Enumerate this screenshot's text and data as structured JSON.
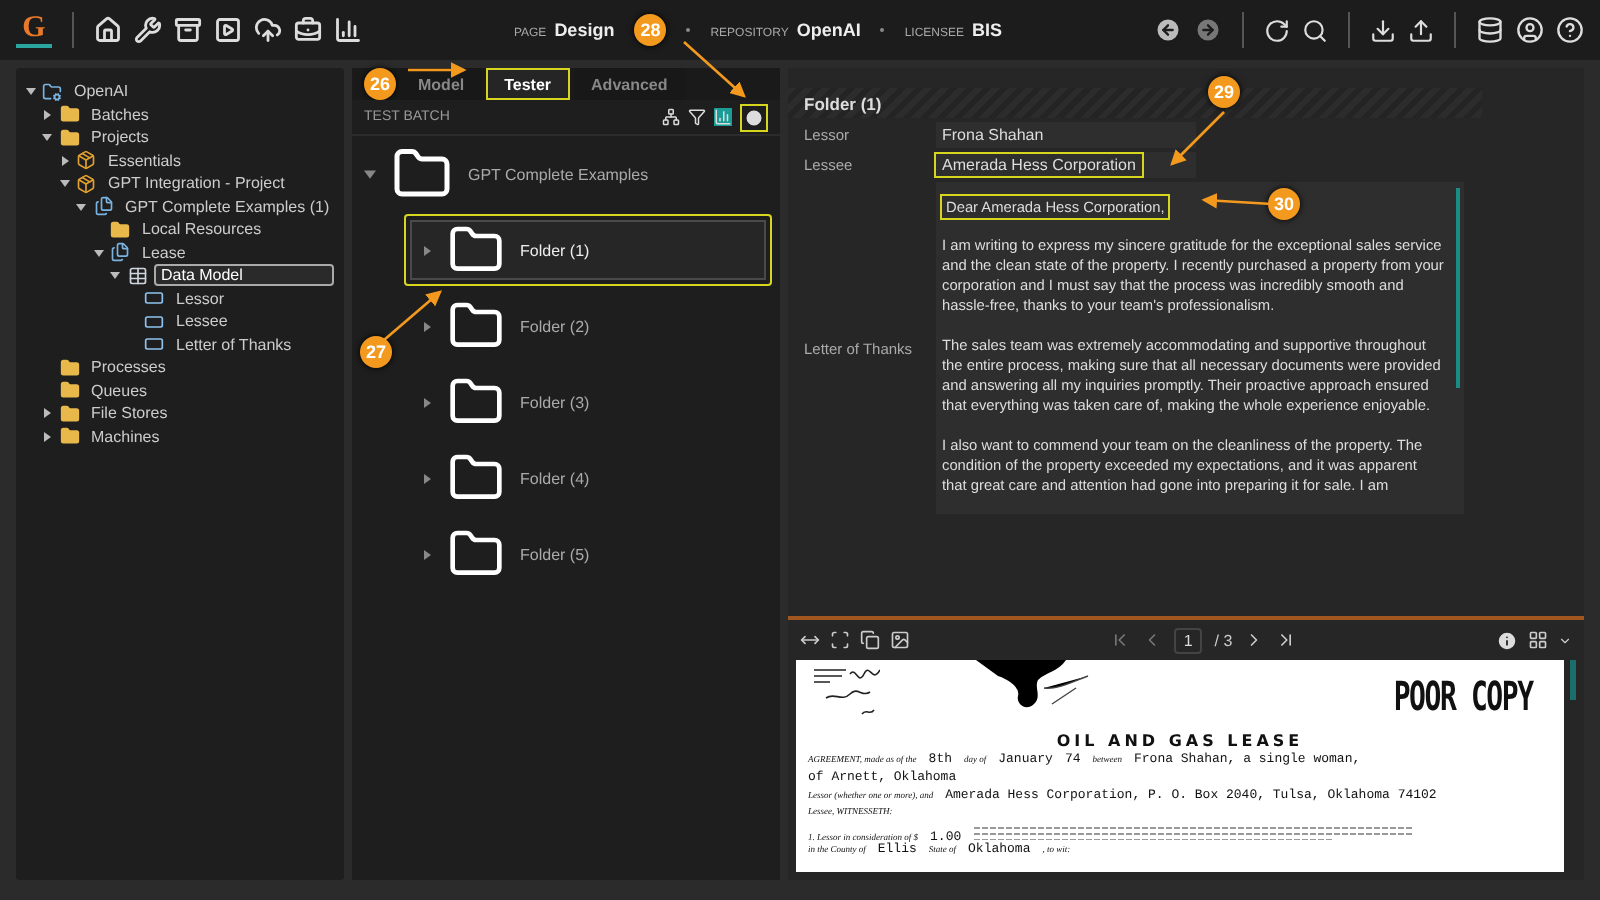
{
  "topbar": {
    "logo": "G",
    "context": [
      {
        "label": "PAGE",
        "value": "Design"
      },
      {
        "label": "REPOSITORY",
        "value": "OpenAI"
      },
      {
        "label": "LICENSEE",
        "value": "BIS"
      }
    ],
    "callout": {
      "number": "28"
    }
  },
  "tree": [
    {
      "label": "OpenAI",
      "kind": "repo",
      "expanded": true,
      "selected": false,
      "children": [
        {
          "label": "Batches",
          "kind": "folder",
          "expanded": false,
          "selected": false
        },
        {
          "label": "Projects",
          "kind": "folder",
          "expanded": true,
          "selected": false,
          "children": [
            {
              "label": "Essentials",
              "kind": "project",
              "expanded": false,
              "selected": false
            },
            {
              "label": "GPT Integration - Project",
              "kind": "project",
              "expanded": true,
              "selected": false,
              "children": [
                {
                  "label": "GPT Complete Examples (1)",
                  "kind": "examples",
                  "expanded": true,
                  "selected": false,
                  "children": [
                    {
                      "label": "Local Resources",
                      "kind": "folder",
                      "selected": false
                    },
                    {
                      "label": "Lease",
                      "kind": "examples",
                      "expanded": true,
                      "selected": false,
                      "children": [
                        {
                          "label": "Data Model",
                          "kind": "model",
                          "expanded": true,
                          "selected": true,
                          "children": [
                            {
                              "label": "Lessor",
                              "kind": "field",
                              "selected": false
                            },
                            {
                              "label": "Lessee",
                              "kind": "field",
                              "selected": false
                            },
                            {
                              "label": "Letter of Thanks",
                              "kind": "field",
                              "selected": false
                            }
                          ]
                        }
                      ]
                    }
                  ]
                }
              ]
            }
          ]
        },
        {
          "label": "Processes",
          "kind": "folder",
          "selected": false
        },
        {
          "label": "Queues",
          "kind": "folder",
          "selected": false
        },
        {
          "label": "File Stores",
          "kind": "folder",
          "expanded": false,
          "selected": false
        },
        {
          "label": "Machines",
          "kind": "folder",
          "expanded": false,
          "selected": false
        }
      ]
    }
  ],
  "tester": {
    "callout": {
      "number": "26"
    },
    "tabs": [
      {
        "label": "Model",
        "selected": false,
        "highlighted": false
      },
      {
        "label": "Tester",
        "selected": true,
        "highlighted": true
      },
      {
        "label": "Advanced",
        "selected": false,
        "highlighted": false
      }
    ],
    "toolbar_title": "TEST BATCH",
    "run_highlighted": true,
    "root": {
      "label": "GPT Complete Examples",
      "expanded": true
    },
    "folders": [
      {
        "label": "Folder (1)",
        "selected": true,
        "highlighted": true
      },
      {
        "label": "Folder (2)",
        "selected": false,
        "highlighted": false
      },
      {
        "label": "Folder (3)",
        "selected": false,
        "highlighted": false
      },
      {
        "label": "Folder (4)",
        "selected": false,
        "highlighted": false
      },
      {
        "label": "Folder (5)",
        "selected": false,
        "highlighted": false
      }
    ],
    "folder_callout": {
      "number": "27"
    }
  },
  "detail": {
    "title": "Folder (1)",
    "fields": [
      {
        "label": "Lessor",
        "kind": "line",
        "value": "Frona Shahan",
        "highlighted": false
      },
      {
        "label": "Lessee",
        "kind": "line",
        "value": "Amerada Hess Corporation",
        "highlighted": true
      },
      {
        "label": "Letter of Thanks",
        "kind": "text",
        "greeting": "Dear Amerada Hess Corporation,",
        "greeting_highlighted": true,
        "paragraphs": [
          "I am writing to express my sincere gratitude for the exceptional sales service and the clean state of the property. I recently purchased a property from your corporation and I must say that the process was incredibly smooth and hassle-free, thanks to your team's professionalism.",
          "The sales team was extremely accommodating and supportive throughout the entire process, making sure that all necessary documents were provided and answering all my inquiries promptly. Their proactive approach ensured that everything was taken care of, making the whole experience enjoyable.",
          "I also want to commend your team on the cleanliness of the property. The condition of the property exceeded my expectations, and it was apparent that great care and attention had gone into preparing it for sale. I am"
        ]
      }
    ],
    "callouts": [
      {
        "number": "29"
      },
      {
        "number": "30"
      }
    ]
  },
  "viewer": {
    "page": "1",
    "total": "/ 3",
    "document": {
      "stamp": "POOR COPY",
      "title": "OIL AND GAS LEASE",
      "lines": [
        [
          {
            "kind": "print",
            "text": "AGREEMENT, made as of the"
          },
          {
            "kind": "typed",
            "text": "8th"
          },
          {
            "kind": "print",
            "text": "day of"
          },
          {
            "kind": "typed",
            "text": "January"
          },
          {
            "kind": "typed",
            "text": "74"
          },
          {
            "kind": "print",
            "text": "between"
          },
          {
            "kind": "typed",
            "text": "Frona Shahan, a single woman,"
          }
        ],
        [
          {
            "kind": "typed",
            "text": "of Arnett, Oklahoma"
          }
        ],
        [
          {
            "kind": "print",
            "text": "Lessor (whether one or more), and"
          },
          {
            "kind": "typed",
            "text": "Amerada Hess Corporation, P. O. Box 2040, Tulsa, Oklahoma 74102"
          }
        ],
        [
          {
            "kind": "print",
            "text": "Lessee, WITNESSETH:"
          }
        ],
        [
          {
            "kind": "print",
            "text": "1. Lessor in consideration of $"
          },
          {
            "kind": "typed",
            "text": "1.00"
          },
          {
            "kind": "fine"
          }
        ],
        [
          {
            "kind": "print",
            "text": "in the County of"
          },
          {
            "kind": "typed",
            "text": "Ellis"
          },
          {
            "kind": "print",
            "text": "State of"
          },
          {
            "kind": "typed",
            "text": "Oklahoma"
          },
          {
            "kind": "print",
            "text": ", to wit:"
          }
        ]
      ]
    }
  }
}
